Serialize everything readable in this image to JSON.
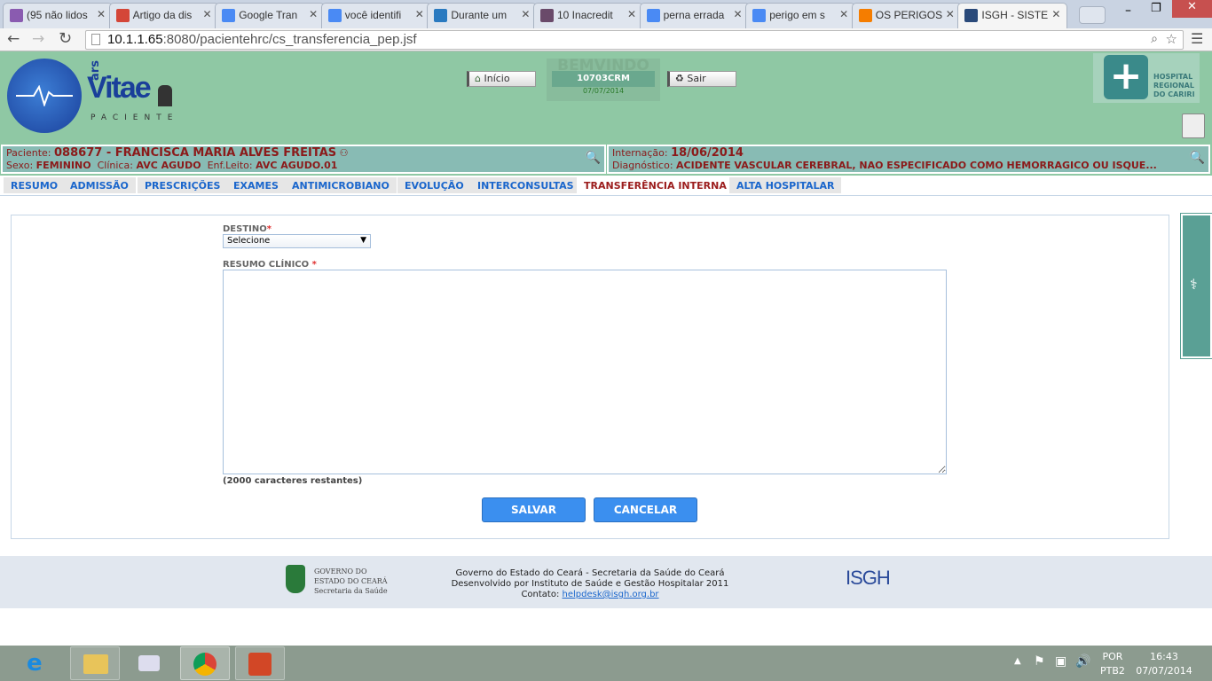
{
  "browser": {
    "tabs": [
      {
        "title": "(95 não lidos",
        "icon": "mail-icon",
        "color": "#8a5bb0"
      },
      {
        "title": "Artigo da dis",
        "icon": "gmail-icon",
        "color": "#d44638"
      },
      {
        "title": "Google Tran",
        "icon": "translate-icon",
        "color": "#4a8af4"
      },
      {
        "title": "você identifi",
        "icon": "google-icon",
        "color": "#4a8af4"
      },
      {
        "title": "Durante um",
        "icon": "site-icon",
        "color": "#2a7ac0"
      },
      {
        "title": "10 Inacredit",
        "icon": "site-icon",
        "color": "#6a4a6a"
      },
      {
        "title": "perna errada",
        "icon": "google-icon",
        "color": "#4a8af4"
      },
      {
        "title": "perigo em s",
        "icon": "google-icon",
        "color": "#4a8af4"
      },
      {
        "title": "OS PERIGOS",
        "icon": "blogger-icon",
        "color": "#f57d00"
      },
      {
        "title": "ISGH - SISTE",
        "icon": "isgh-icon",
        "color": "#2a4a7a"
      }
    ],
    "url_host": "10.1.1.65",
    "url_rest": ":8080/pacientehrc/cs_transferencia_pep.jsf"
  },
  "header": {
    "logo_ars": "ars",
    "logo_vitae": "Vitae",
    "logo_paciente": "PACIENTE",
    "inicio": "Início",
    "welcome": "BEMVINDO",
    "user": "10703CRM",
    "date": "07/07/2014",
    "sair": "Sair",
    "hospital": "HOSPITAL REGIONAL DO CARIRI"
  },
  "patient": {
    "paciente_label": "Paciente:",
    "paciente": "088677 - FRANCISCA MARIA ALVES FREITAS",
    "sexo_label": "Sexo:",
    "sexo": "FEMININO",
    "clinica_label": "Clínica:",
    "clinica": "AVC AGUDO",
    "leito_label": "Enf.Leito:",
    "leito": "AVC AGUDO.01",
    "internacao_label": "Internação:",
    "internacao": "18/06/2014",
    "diag_label": "Diagnóstico:",
    "diagnostico": "ACIDENTE VASCULAR CEREBRAL, NAO ESPECIFICADO COMO HEMORRAGICO OU ISQUE..."
  },
  "nav": [
    "RESUMO",
    "ADMISSÃO",
    "PRESCRIÇÕES",
    "EXAMES",
    "ANTIMICROBIANO",
    "EVOLUÇÃO",
    "INTERCONSULTAS",
    "TRANSFERÊNCIA INTERNA",
    "ALTA HOSPITALAR"
  ],
  "form": {
    "destino_label": "DESTINO",
    "destino_value": "Selecione",
    "resumo_label": "RESUMO CLÍNICO",
    "resumo_value": "",
    "remaining": "(2000 caracteres restantes)",
    "salvar": "SALVAR",
    "cancelar": "CANCELAR"
  },
  "footer": {
    "gov_logo": "GOVERNO DO ESTADO DO CEARÁ Secretaria da Saúde",
    "line1": "Governo do Estado do Ceará - Secretaria da Saúde do Ceará",
    "line2": "Desenvolvido por Instituto de Saúde e Gestão Hospitalar 2011",
    "contact_label": "Contato:",
    "contact_email": "helpdesk@isgh.org.br",
    "isgh_logo": "ISGH"
  },
  "taskbar": {
    "lang1": "POR",
    "lang2": "PTB2",
    "time": "16:43",
    "date": "07/07/2014"
  }
}
